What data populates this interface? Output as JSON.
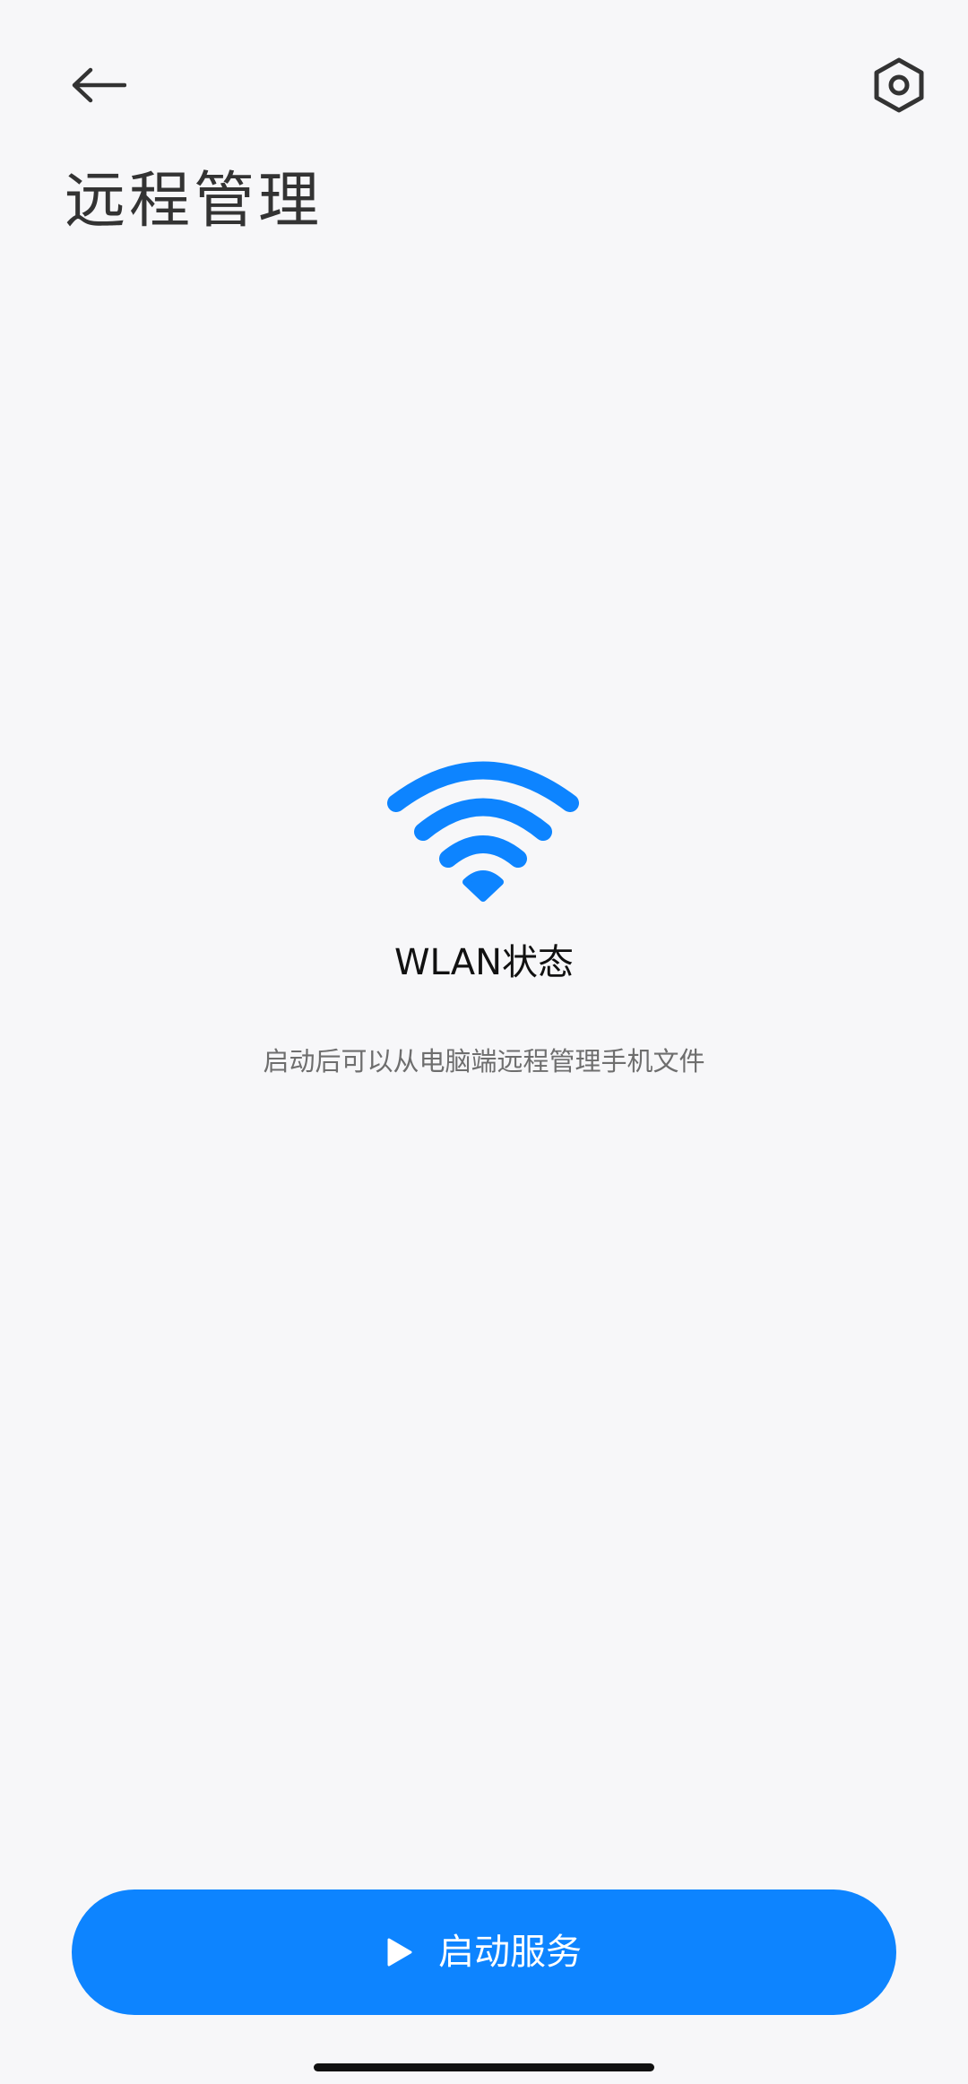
{
  "header": {
    "back_icon": "arrow-left-icon",
    "settings_icon": "hexagon-gear-icon",
    "title": "远程管理"
  },
  "status": {
    "icon": "wifi-icon",
    "title": "WLAN状态",
    "description": "启动后可以从电脑端远程管理手机文件"
  },
  "actions": {
    "start_icon": "play-icon",
    "start_label": "启动服务"
  },
  "colors": {
    "accent": "#0d84ff",
    "background": "#f7f7f9",
    "title_text": "#333333",
    "secondary_text": "#6e6e6e"
  }
}
